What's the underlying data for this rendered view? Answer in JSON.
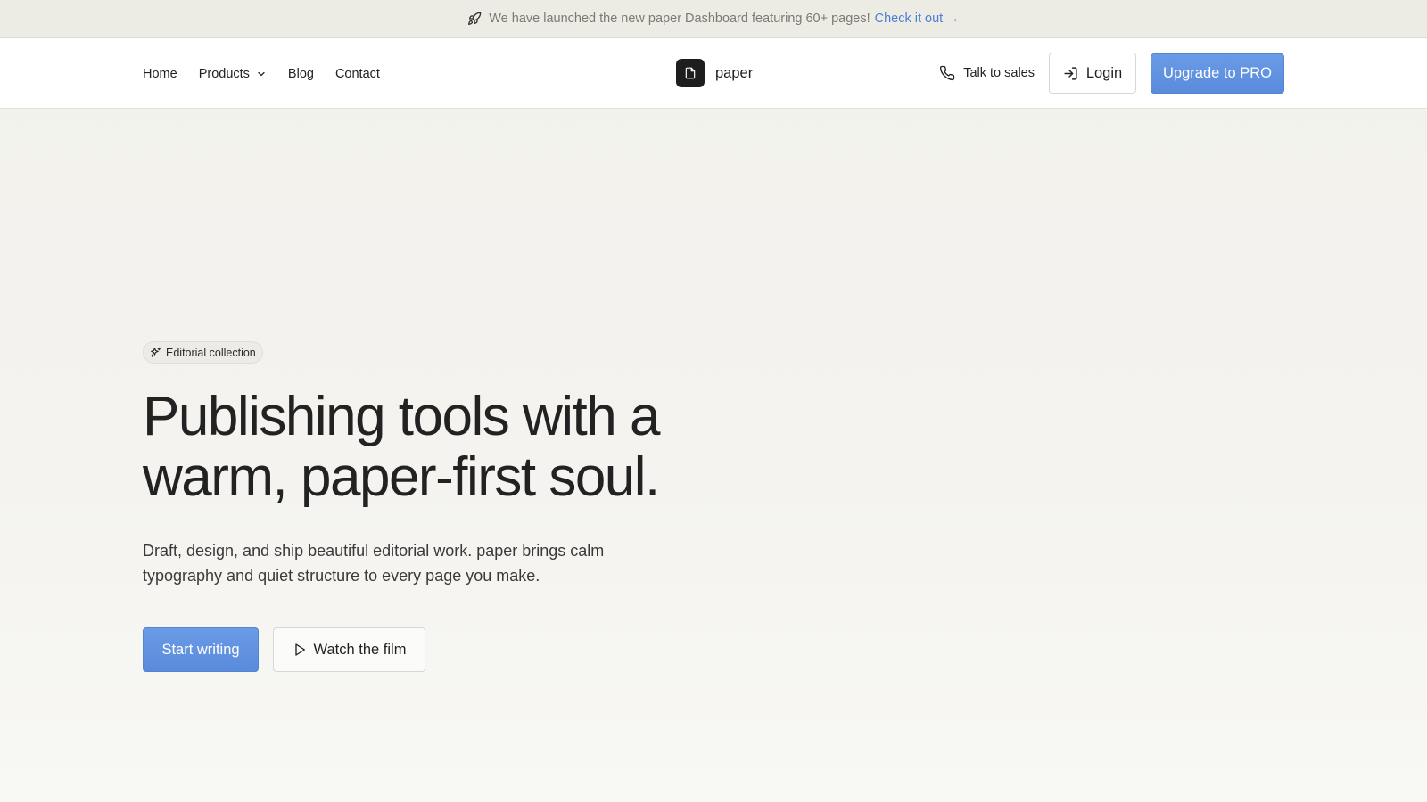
{
  "announcement": {
    "icon": "rocket-icon",
    "text": "We have launched the new paper Dashboard featuring 60+ pages!",
    "link_label": "Check it out →"
  },
  "nav": {
    "items": [
      {
        "label": "Home"
      },
      {
        "label": "Products",
        "has_dropdown": true
      },
      {
        "label": "Blog"
      },
      {
        "label": "Contact"
      }
    ]
  },
  "brand": {
    "icon": "document-icon",
    "name": "paper"
  },
  "header_actions": {
    "sales_label": "Talk to sales",
    "login_label": "Login",
    "upgrade_label": "Upgrade to PRO"
  },
  "hero": {
    "chip_label": "Editorial collection",
    "headline": "Publishing tools with a warm, paper-first soul.",
    "subtext": "Draft, design, and ship beautiful editorial work. paper brings calm typography and quiet structure to every page you make.",
    "primary_cta": "Start writing",
    "secondary_cta": "Watch the film"
  },
  "colors": {
    "accent": "#5a8bdc",
    "link": "#4a7fd6",
    "background": "#f3f2ee",
    "announcement_bg": "#edece4"
  }
}
